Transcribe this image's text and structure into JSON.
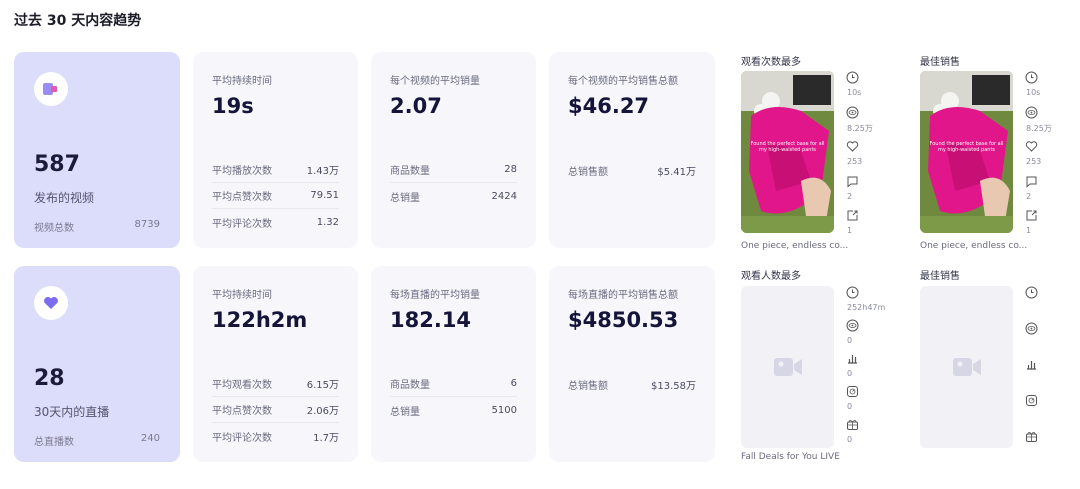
{
  "page": {
    "title": "过去 30 天内容趋势"
  },
  "video": {
    "summary": {
      "count": "587",
      "label": "发布的视频",
      "total_label": "视频总数",
      "total_value": "8739"
    },
    "duration": {
      "label": "平均持续时间",
      "value": "19s",
      "rows": [
        {
          "label": "平均播放次数",
          "value": "1.43万"
        },
        {
          "label": "平均点赞次数",
          "value": "79.51"
        },
        {
          "label": "平均评论次数",
          "value": "1.32"
        }
      ]
    },
    "sales": {
      "label": "每个视频的平均销量",
      "value": "2.07",
      "rows": [
        {
          "label": "商品数量",
          "value": "28"
        },
        {
          "label": "总销量",
          "value": "2424"
        }
      ]
    },
    "revenue": {
      "label": "每个视频的平均销售总额",
      "value": "$46.27",
      "rows": [
        {
          "label": "总销售额",
          "value": "$5.41万"
        }
      ]
    },
    "most_viewed": {
      "title": "观看次数最多",
      "caption": "One piece, endless co...",
      "stats": [
        "10s",
        "8.25万",
        "253",
        "2",
        "1"
      ]
    },
    "best_selling": {
      "title": "最佳销售",
      "caption": "One piece, endless co...",
      "stats": [
        "10s",
        "8.25万",
        "253",
        "2",
        "1"
      ]
    },
    "thumb_text": "Found the perfect base for all my high-waisted pants"
  },
  "live": {
    "summary": {
      "count": "28",
      "label": "30天内的直播",
      "total_label": "总直播数",
      "total_value": "240"
    },
    "duration": {
      "label": "平均持续时间",
      "value": "122h2m",
      "rows": [
        {
          "label": "平均观看次数",
          "value": "6.15万"
        },
        {
          "label": "平均点赞次数",
          "value": "2.06万"
        },
        {
          "label": "平均评论次数",
          "value": "1.7万"
        }
      ]
    },
    "sales": {
      "label": "每场直播的平均销量",
      "value": "182.14",
      "rows": [
        {
          "label": "商品数量",
          "value": "6"
        },
        {
          "label": "总销量",
          "value": "5100"
        }
      ]
    },
    "revenue": {
      "label": "每场直播的平均销售总额",
      "value": "$4850.53",
      "rows": [
        {
          "label": "总销售额",
          "value": "$13.58万"
        }
      ]
    },
    "most_viewed": {
      "title": "观看人数最多",
      "caption": "Fall Deals for You LIVE",
      "stats": [
        "252h47m",
        "0",
        "0",
        "0",
        "0"
      ]
    },
    "best_selling": {
      "title": "最佳销售"
    }
  },
  "colors": {
    "accent": "#7c6cf0",
    "summary_bg": "#dcdcfb",
    "card_bg": "#f7f7fb",
    "thumb_pink": "#e0168a"
  }
}
